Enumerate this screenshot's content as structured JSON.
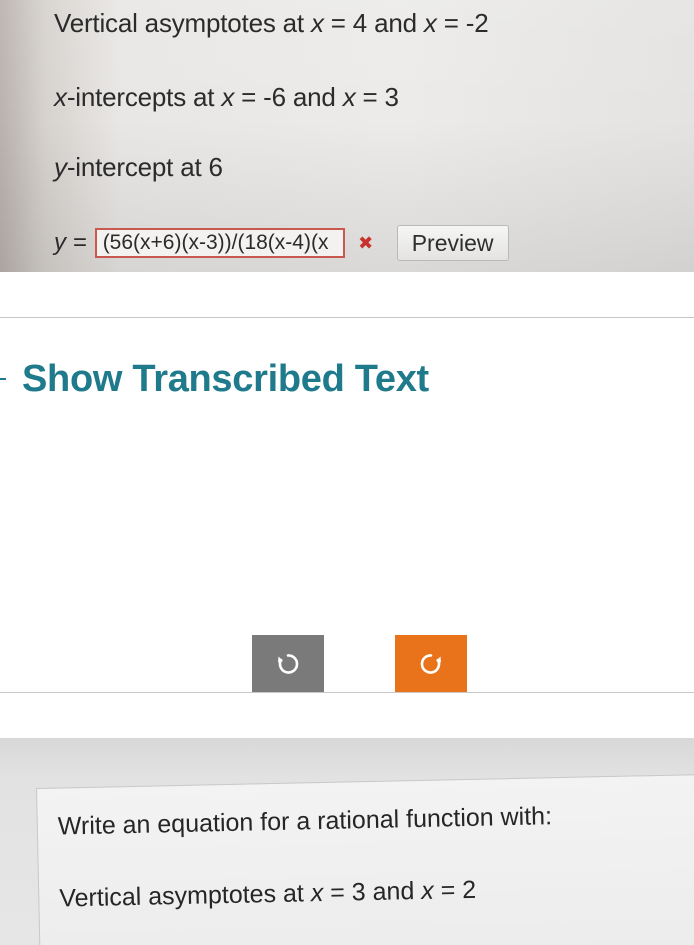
{
  "top_panel": {
    "asymptotes_prefix": "Vertical asymptotes at ",
    "asymptotes_var1": "x",
    "asymptotes_mid": " = 4 and ",
    "asymptotes_var2": "x",
    "asymptotes_suffix": " = -2",
    "xint_var0": "x",
    "xint_prefix": "-intercepts at ",
    "xint_var1": "x",
    "xint_mid": " = -6 and ",
    "xint_var2": "x",
    "xint_suffix": " = 3",
    "yint_var": "y",
    "yint_text": "-intercept at 6",
    "equation_label": "y =",
    "equation_value": "(56(x+6)(x-3))/(18(x-4)(x",
    "wrong_mark": "✖",
    "preview_label": "Preview"
  },
  "middle": {
    "show_transcribed_label": "Show Transcribed Text"
  },
  "bottom_panel": {
    "prompt_text": "Write an equation for a rational function with:",
    "asymptotes_prefix": "Vertical asymptotes at ",
    "asymptotes_var1": "x",
    "asymptotes_mid": " = 3 and ",
    "asymptotes_var2": "x",
    "asymptotes_suffix": " = 2"
  },
  "colors": {
    "link": "#1f7a8c",
    "rotate_left_bg": "#7a7a7a",
    "rotate_right_bg": "#e8731a",
    "error": "#c7322c"
  },
  "icons": {
    "rotate_left": "rotate-counterclockwise-icon",
    "rotate_right": "rotate-clockwise-icon"
  }
}
